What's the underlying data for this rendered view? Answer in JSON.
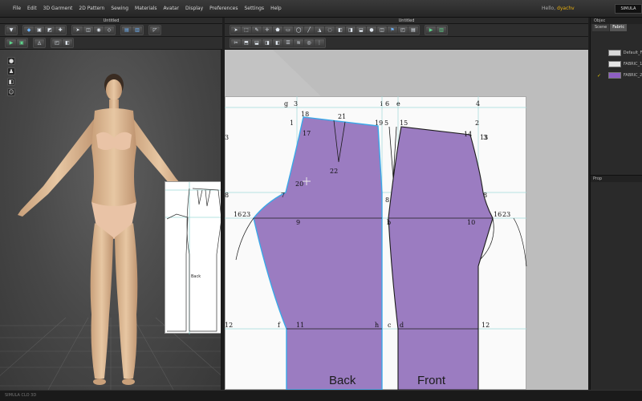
{
  "menubar": {
    "items": [
      "File",
      "Edit",
      "3D Garment",
      "2D Pattern",
      "Sewing",
      "Materials",
      "Avatar",
      "Display",
      "Preferences",
      "Settings",
      "Help"
    ],
    "greeting_prefix": "Hello,",
    "username": "dyachv",
    "brand": "SIMULA"
  },
  "panes": {
    "left_title": "Untitled",
    "right_title": "Untitled"
  },
  "right_panel": {
    "header": "Objec",
    "tabs": [
      "Scene",
      "Fabric"
    ],
    "fabrics": [
      {
        "name": "Default_F",
        "swatch_color": "#d8d8d8",
        "checked": false
      },
      {
        "name": "FABRIC_1",
        "swatch_color": "#e6e6e6",
        "checked": false
      },
      {
        "name": "FABRIC_2",
        "swatch_color": "#8e5fc4",
        "checked": true
      }
    ],
    "property_label": "Prop"
  },
  "viewport3d": {
    "mini_pattern_label": "Back"
  },
  "pattern": {
    "colors": {
      "fill": "#9b7cc1",
      "selected_outline": "#3aa8e8",
      "grid": "#9fd9d8"
    },
    "top_labels": [
      "g",
      "3",
      "i",
      "6",
      "e",
      "4"
    ],
    "point_labels": [
      "1",
      "18",
      "21",
      "19",
      "5",
      "15",
      "2",
      "17",
      "14",
      "13",
      "22",
      "20",
      "7",
      "8",
      "16",
      "23",
      "9",
      "b",
      "10",
      "16",
      "23",
      "11",
      "12",
      "f",
      "h",
      "c",
      "d",
      "12",
      "3",
      "8",
      "3",
      "8"
    ],
    "piece_labels": {
      "back": "Back",
      "front": "Front"
    }
  },
  "statusbar": {
    "text": "SIMULA CLO 3D"
  }
}
